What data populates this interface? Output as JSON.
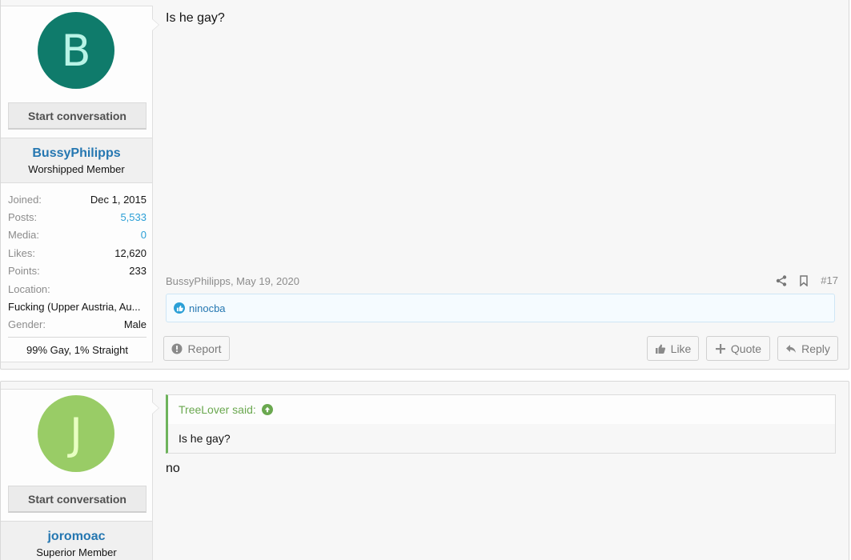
{
  "post1": {
    "avatar_letter": "B",
    "start_conversation": "Start conversation",
    "username": "BussyPhilipps",
    "user_title": "Worshipped Member",
    "stats": [
      {
        "key": "Joined:",
        "value": "Dec 1, 2015"
      },
      {
        "key": "Posts:",
        "value": "5,533"
      },
      {
        "key": "Media:",
        "value": "0"
      },
      {
        "key": "Likes:",
        "value": "12,620"
      },
      {
        "key": "Points:",
        "value": "233"
      }
    ],
    "location_label": "Location:",
    "location_value": "Fucking (Upper Austria, Au...",
    "gender_label": "Gender:",
    "gender_value": "Male",
    "custom_field": "99% Gay, 1% Straight",
    "message": "Is he gay?",
    "meta_author": "BussyPhilipps",
    "meta_date": "May 19, 2020",
    "post_number": "#17",
    "reaction_user": "ninocba",
    "report_label": "Report",
    "like_label": "Like",
    "quote_label": "Quote",
    "reply_label": "Reply"
  },
  "post2": {
    "avatar_letter": "J",
    "start_conversation": "Start conversation",
    "username": "joromoac",
    "user_title": "Superior Member",
    "quote_author": "TreeLover said:",
    "quote_text": "Is he gay?",
    "message": "no"
  },
  "colors": {
    "accent_link": "#2577b1",
    "avatar_b": "#0f7b6b",
    "avatar_j": "#99cc66",
    "quote_green": "#6aa84f"
  }
}
